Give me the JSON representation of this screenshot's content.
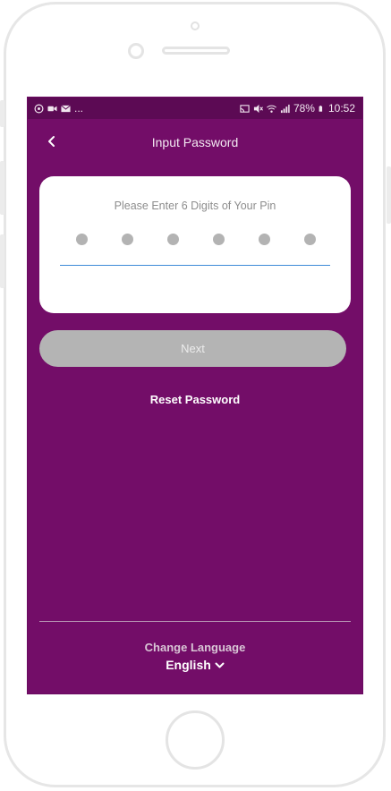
{
  "status_bar": {
    "left_more": "...",
    "battery_percent": "78%",
    "time": "10:52"
  },
  "header": {
    "title": "Input Password"
  },
  "pin_card": {
    "label": "Please Enter 6 Digits of Your Pin",
    "digits_total": 6
  },
  "actions": {
    "next_label": "Next",
    "reset_label": "Reset Password"
  },
  "footer": {
    "change_language_label": "Change Language",
    "selected_language": "English"
  },
  "colors": {
    "background": "#730d68",
    "status_bar": "#5c0a54",
    "card": "#ffffff",
    "pin_dot": "#b3b3b3",
    "underline": "#3c8ad8",
    "next_disabled": "#b4b4b4"
  }
}
